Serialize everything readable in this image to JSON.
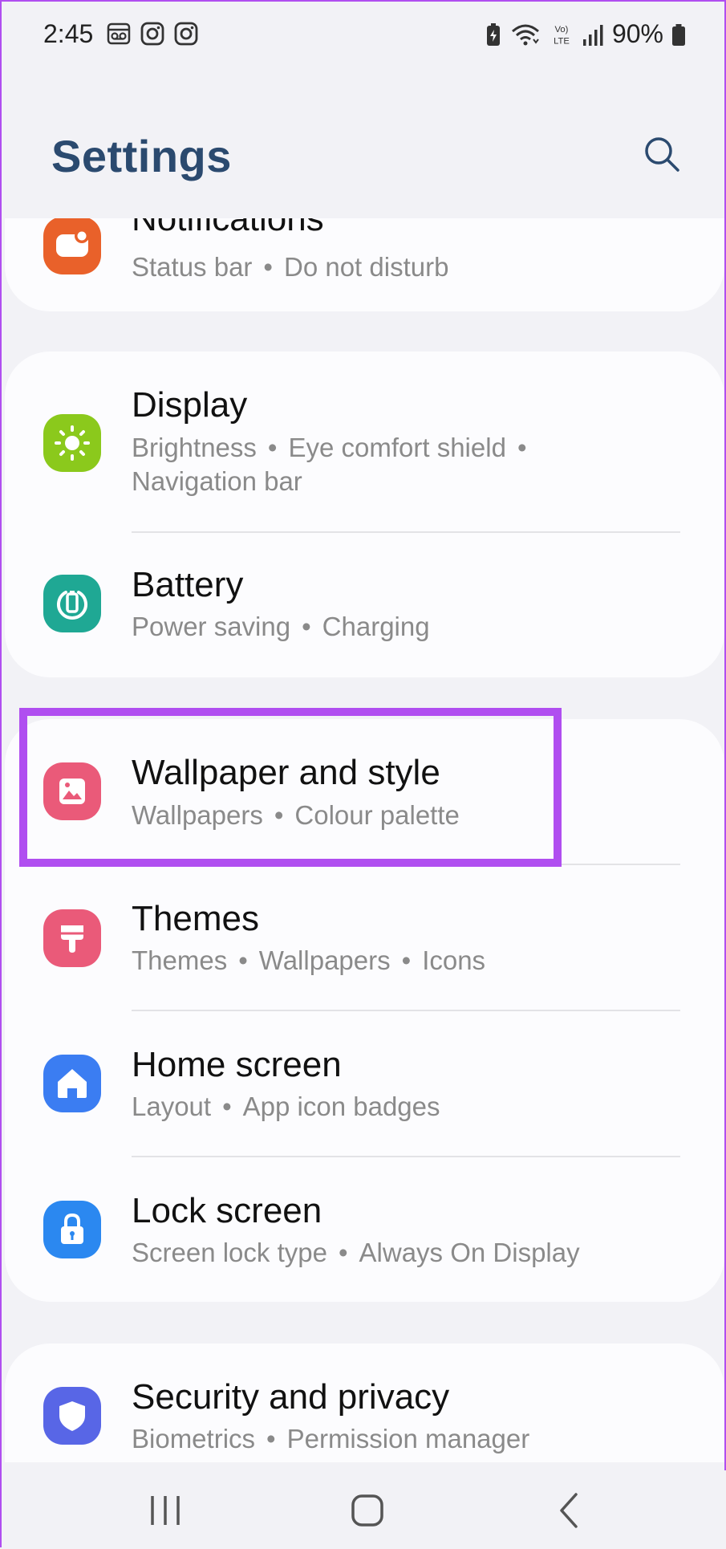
{
  "status_bar": {
    "time": "2:45",
    "left_icons": [
      "voicemail-icon",
      "instagram-icon",
      "instagram-icon"
    ],
    "right_icons": [
      "battery-saver-icon",
      "wifi-icon",
      "volte-icon",
      "signal-icon",
      "battery-icon"
    ],
    "volte_label_top": "Vo)",
    "volte_label_bottom": "LTE",
    "battery": "90%"
  },
  "header": {
    "title": "Settings",
    "search_icon": "search-icon"
  },
  "items": {
    "notifications": {
      "title": "Notifications",
      "sub": [
        "Status bar",
        "Do not disturb"
      ],
      "color": "#e9612a"
    },
    "display": {
      "title": "Display",
      "sub": [
        "Brightness",
        "Eye comfort shield",
        "Navigation bar"
      ],
      "color": "#8bc91c"
    },
    "battery": {
      "title": "Battery",
      "sub": [
        "Power saving",
        "Charging"
      ],
      "color": "#1fa894"
    },
    "wallpaper": {
      "title": "Wallpaper and style",
      "sub": [
        "Wallpapers",
        "Colour palette"
      ],
      "color": "#ea5a79"
    },
    "themes": {
      "title": "Themes",
      "sub": [
        "Themes",
        "Wallpapers",
        "Icons"
      ],
      "color": "#ea5a79"
    },
    "home_screen": {
      "title": "Home screen",
      "sub": [
        "Layout",
        "App icon badges"
      ],
      "color": "#3b7df2"
    },
    "lock_screen": {
      "title": "Lock screen",
      "sub": [
        "Screen lock type",
        "Always On Display"
      ],
      "color": "#2b88f0"
    },
    "security": {
      "title": "Security and privacy",
      "sub": [
        "Biometrics",
        "Permission manager"
      ],
      "color": "#5866e6"
    }
  },
  "highlight_color": "#b04ef0",
  "nav": {
    "recents": "recents-icon",
    "home": "home-icon",
    "back": "back-icon"
  }
}
